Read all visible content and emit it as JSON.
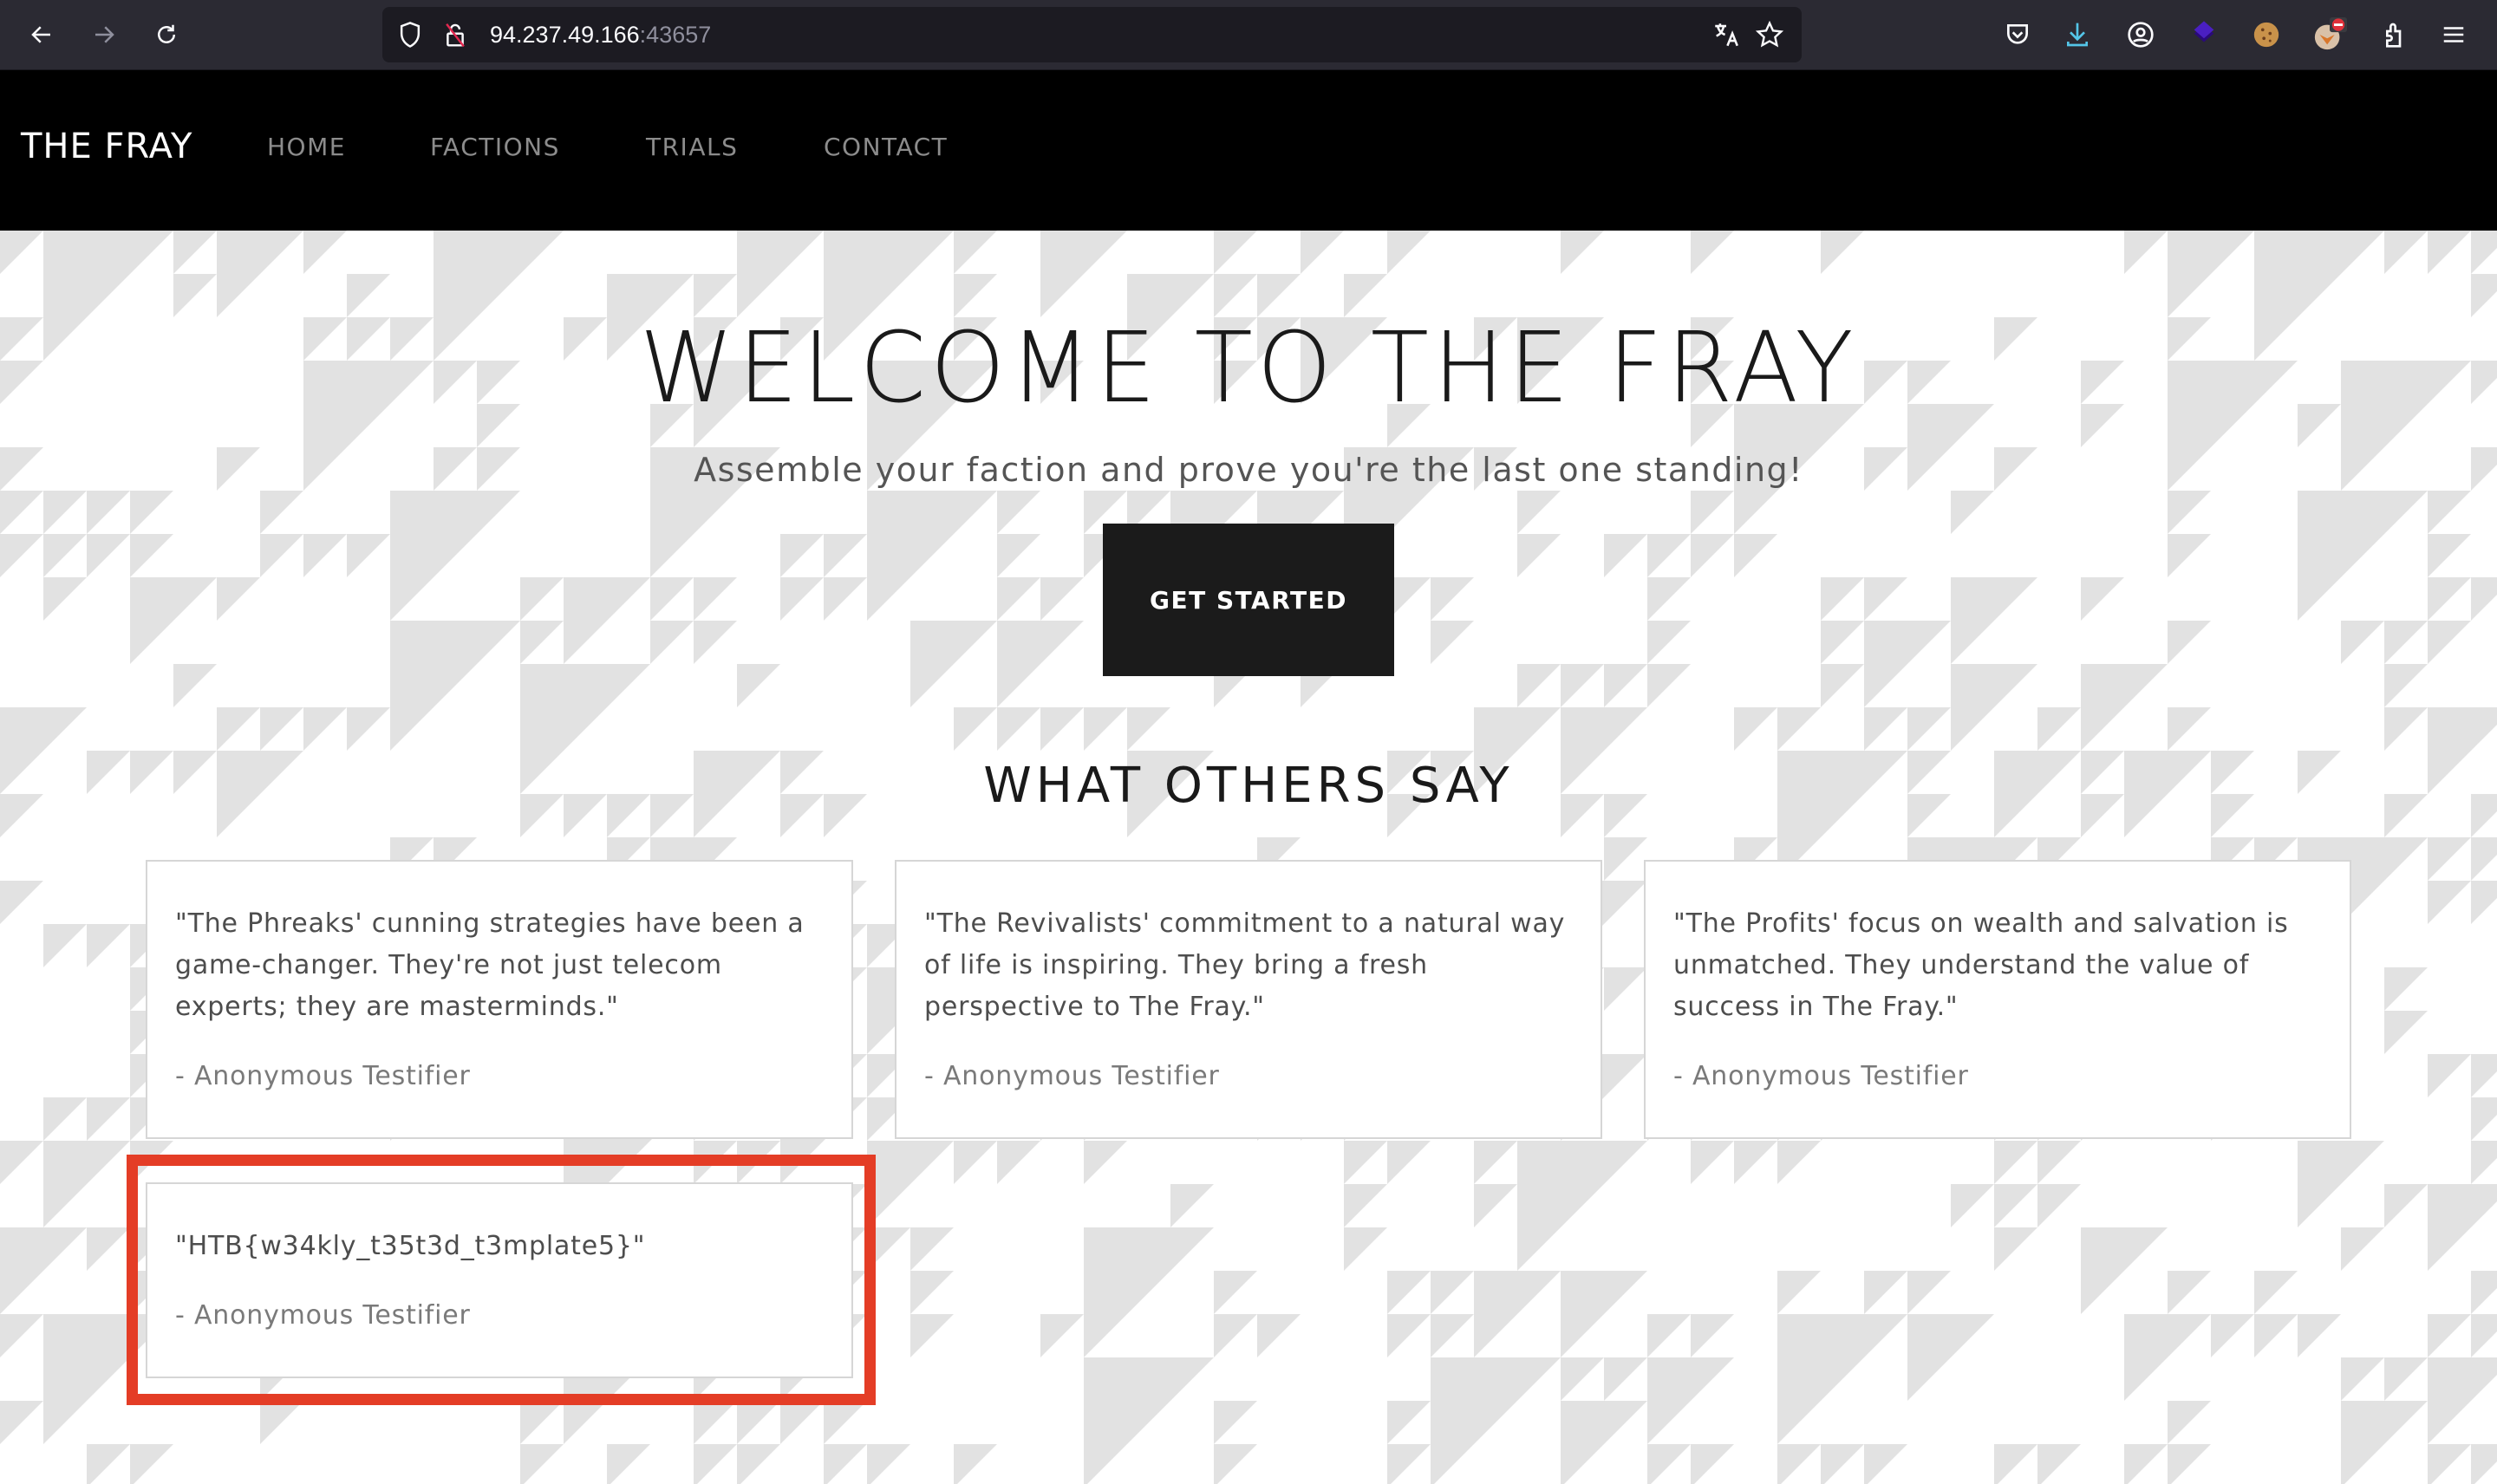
{
  "browser": {
    "url_host": "94.237.49.166",
    "url_port": ":43657",
    "toolbar_icons": [
      "pocket-icon",
      "download-icon",
      "account-icon",
      "extension-layers-icon",
      "cookie-extension-icon",
      "fox-extension-icon",
      "extensions-puzzle-icon",
      "menu-icon"
    ]
  },
  "nav": {
    "brand": "THE FRAY",
    "items": [
      {
        "label": "HOME"
      },
      {
        "label": "FACTIONS"
      },
      {
        "label": "TRIALS"
      },
      {
        "label": "CONTACT"
      }
    ]
  },
  "hero": {
    "title": "WELCOME TO THE FRAY",
    "subtitle": "Assemble your faction and prove you're the last one standing!",
    "cta_label": "GET STARTED"
  },
  "testimonials": {
    "title": "WHAT OTHERS SAY",
    "items": [
      {
        "quote": "\"The Phreaks' cunning strategies have been a game-changer. They're not just telecom experts; they are masterminds.\"",
        "author": "- Anonymous Testifier"
      },
      {
        "quote": "\"The Revivalists' commitment to a natural way of life is inspiring. They bring a fresh perspective to The Fray.\"",
        "author": "- Anonymous Testifier"
      },
      {
        "quote": "\"The Profits' focus on wealth and salvation is unmatched. They understand the value of success in The Fray.\"",
        "author": "- Anonymous Testifier"
      },
      {
        "quote": "\"HTB{w34kly_t35t3d_t3mplate5}\"",
        "author": "- Anonymous Testifier"
      }
    ]
  },
  "colors": {
    "highlight": "#e43d26",
    "pattern": "#e2e2e2",
    "navbar": "#000000",
    "button": "#1b1b1b"
  }
}
